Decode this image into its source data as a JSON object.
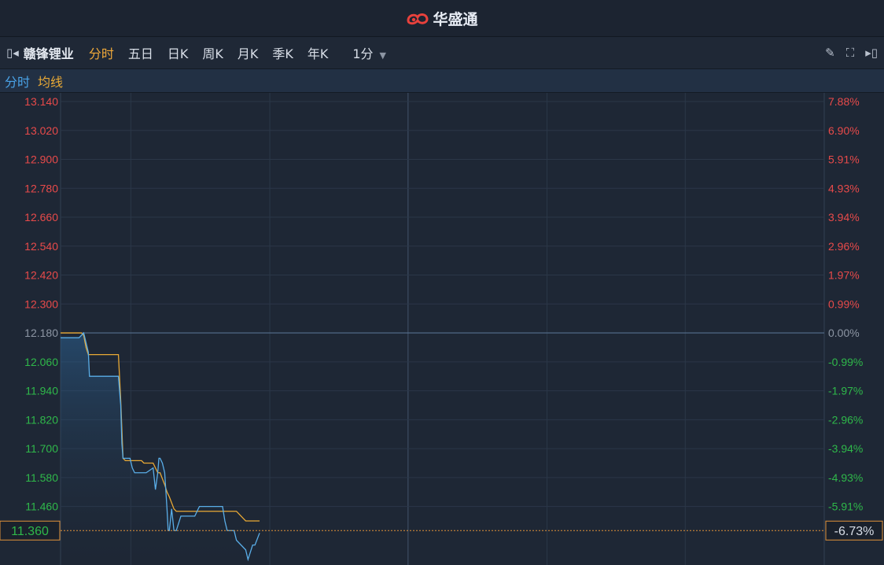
{
  "app": {
    "brand": "华盛通"
  },
  "toolbar": {
    "stock_name": "赣锋锂业",
    "tabs": [
      "分时",
      "五日",
      "日K",
      "周K",
      "月K",
      "季K",
      "年K"
    ],
    "active_tab": "分时",
    "period": "1分"
  },
  "legend": {
    "price_label": "分时",
    "avg_label": "均线"
  },
  "colors": {
    "up": "#e84a4a",
    "down": "#2fb84a",
    "price_line": "#5aaee8",
    "avg_line": "#e9a935",
    "zero": "#8d96a4"
  },
  "chart_data": {
    "type": "line",
    "prev_close": 12.18,
    "ylim": [
      11.24,
      13.14
    ],
    "price_ticks": [
      "13.140",
      "13.020",
      "12.900",
      "12.780",
      "12.660",
      "12.540",
      "12.420",
      "12.300",
      "12.180",
      "12.060",
      "11.940",
      "11.820",
      "11.700",
      "11.580",
      "11.460"
    ],
    "pct_ticks": [
      "7.88%",
      "6.90%",
      "5.91%",
      "4.93%",
      "3.94%",
      "2.96%",
      "1.97%",
      "0.99%",
      "0.00%",
      "-0.99%",
      "-1.97%",
      "-2.96%",
      "-3.94%",
      "-4.93%",
      "-5.91%"
    ],
    "current_price": "11.360",
    "current_pct": "-6.73%",
    "total_minutes": 330,
    "series": [
      {
        "name": "分时",
        "x": [
          0,
          8,
          10,
          12,
          12.5,
          13,
          25,
          26,
          26.5,
          27,
          28,
          30,
          31,
          32,
          35,
          37,
          40,
          41,
          42,
          42.5,
          43,
          44,
          45,
          46,
          46.5,
          47,
          48,
          49,
          50,
          52,
          58,
          60,
          61,
          70,
          71,
          72,
          75,
          76,
          80,
          81,
          83,
          84,
          86
        ],
        "y": [
          12.16,
          12.16,
          12.18,
          12.1,
          12.0,
          12.0,
          12.0,
          11.88,
          11.72,
          11.66,
          11.66,
          11.66,
          11.62,
          11.6,
          11.6,
          11.6,
          11.62,
          11.53,
          11.6,
          11.66,
          11.66,
          11.64,
          11.6,
          11.45,
          11.36,
          11.36,
          11.45,
          11.36,
          11.36,
          11.42,
          11.42,
          11.46,
          11.46,
          11.46,
          11.4,
          11.36,
          11.36,
          11.32,
          11.28,
          11.24,
          11.3,
          11.3,
          11.35
        ]
      },
      {
        "name": "均线",
        "x": [
          0,
          9,
          10,
          11,
          12,
          14,
          25,
          26,
          27,
          28,
          35,
          36,
          40,
          42,
          43,
          45,
          46,
          47,
          49,
          50,
          60,
          76,
          79,
          80,
          86
        ],
        "y": [
          12.18,
          12.18,
          12.17,
          12.12,
          12.09,
          12.09,
          12.09,
          11.9,
          11.66,
          11.65,
          11.65,
          11.64,
          11.64,
          11.6,
          11.6,
          11.55,
          11.52,
          11.5,
          11.45,
          11.44,
          11.44,
          11.44,
          11.41,
          11.4,
          11.4
        ]
      }
    ]
  }
}
